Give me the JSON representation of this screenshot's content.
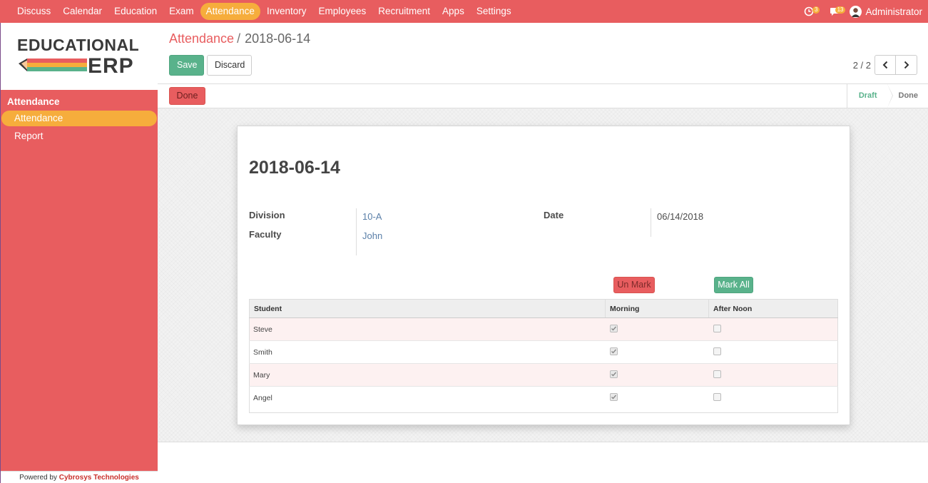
{
  "topnav": {
    "items": [
      {
        "label": "Discuss"
      },
      {
        "label": "Calendar"
      },
      {
        "label": "Education"
      },
      {
        "label": "Exam"
      },
      {
        "label": "Attendance",
        "active": true
      },
      {
        "label": "Inventory"
      },
      {
        "label": "Employees"
      },
      {
        "label": "Recruitment"
      },
      {
        "label": "Apps"
      },
      {
        "label": "Settings"
      }
    ],
    "activity_badge": "3",
    "messages_badge": "13",
    "user_name": "Administrator"
  },
  "sidebar": {
    "logo_top": "EDUCATIONAL",
    "logo_bottom": "ERP",
    "section_title": "Attendance",
    "items": [
      {
        "label": "Attendance",
        "active": true
      },
      {
        "label": "Report"
      }
    ],
    "footer_prefix": "Powered by",
    "footer_brand": "Cybrosys Technologies"
  },
  "control_panel": {
    "breadcrumb_parent": "Attendance",
    "breadcrumb_separator": "/",
    "breadcrumb_current": "2018-06-14",
    "save_label": "Save",
    "discard_label": "Discard",
    "pager_text": "2 / 2"
  },
  "statusbar": {
    "done_button_label": "Done",
    "stages": [
      {
        "label": "Draft",
        "current": true
      },
      {
        "label": "Done"
      }
    ]
  },
  "form": {
    "title": "2018-06-14",
    "division_label": "Division",
    "division_value": "10-A",
    "faculty_label": "Faculty",
    "faculty_value": "John",
    "date_label": "Date",
    "date_value": "06/14/2018",
    "unmark_label": "Un Mark",
    "markall_label": "Mark All",
    "table": {
      "headers": [
        "Student",
        "Morning",
        "After Noon"
      ],
      "rows": [
        {
          "student": "Steve",
          "morning": true,
          "afternoon": false
        },
        {
          "student": "Smith",
          "morning": true,
          "afternoon": false
        },
        {
          "student": "Mary",
          "morning": true,
          "afternoon": false
        },
        {
          "student": "Angel",
          "morning": true,
          "afternoon": false
        }
      ]
    }
  },
  "colors": {
    "brand": "#e85d5f",
    "active_pill": "#f6ad3c",
    "primary_button": "#59b28b",
    "link": "#5a7fa8"
  }
}
